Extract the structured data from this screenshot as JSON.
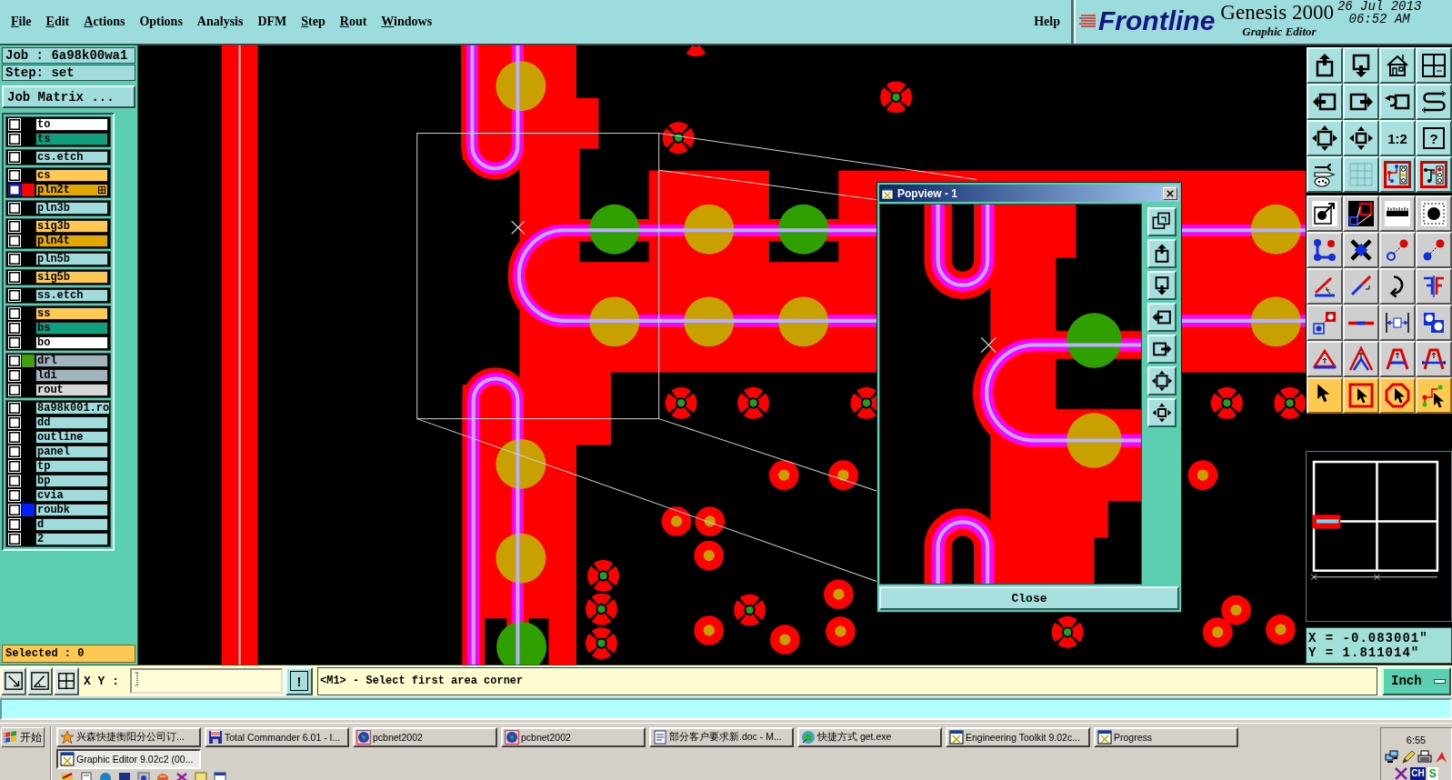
{
  "menu_bar": {
    "items": [
      {
        "label": "File",
        "underlined": true
      },
      {
        "label": "Edit",
        "underlined": true
      },
      {
        "label": "Actions",
        "underlined": true
      },
      {
        "label": "Options",
        "underlined": false
      },
      {
        "label": "Analysis",
        "underlined": false
      },
      {
        "label": "DFM",
        "underlined": false
      },
      {
        "label": "Step",
        "underlined": true
      },
      {
        "label": "Rout",
        "underlined": true
      },
      {
        "label": "Windows",
        "underlined": true
      }
    ],
    "help": {
      "label": "Help",
      "underlined": false
    }
  },
  "brand": {
    "logo": "Frontline",
    "product": "Genesis 2000",
    "subtitle": "Graphic Editor",
    "date": "26 Jul 2013",
    "time": "06:52 AM"
  },
  "job_panel": {
    "job": "Job : 6a98k00wa1",
    "step": "Step: set",
    "matrix_button": "Job Matrix ...",
    "layer_groups": [
      {
        "layers": [
          {
            "name": "to",
            "color": "#ffffff",
            "checked": false,
            "selected": false
          },
          {
            "name": "ts",
            "color": "#10a080",
            "checked": false,
            "selected": false
          }
        ]
      },
      {
        "layers": [
          {
            "name": "cs.etch",
            "color": "#a0dcdc",
            "checked": false,
            "selected": false
          }
        ]
      },
      {
        "layers": [
          {
            "name": "cs",
            "color": "#ffc850",
            "checked": false,
            "selected": false
          },
          {
            "name": "pln2t",
            "color": "#e0a800",
            "swatch": {
              "color": "#ff0000"
            },
            "checked": false,
            "selected": true
          }
        ]
      },
      {
        "layers": [
          {
            "name": "pln3b",
            "color": "#a0dcdc",
            "checked": false,
            "selected": false
          }
        ]
      },
      {
        "layers": [
          {
            "name": "sig3b",
            "color": "#ffc850",
            "checked": false,
            "selected": false
          },
          {
            "name": "pln4t",
            "color": "#e0a800",
            "checked": false,
            "selected": false
          }
        ]
      },
      {
        "layers": [
          {
            "name": "pln5b",
            "color": "#a0dcdc",
            "checked": false,
            "selected": false
          }
        ]
      },
      {
        "layers": [
          {
            "name": "sig5b",
            "color": "#ffc850",
            "checked": false,
            "selected": false
          }
        ]
      },
      {
        "layers": [
          {
            "name": "ss.etch",
            "color": "#a0dcdc",
            "checked": false,
            "selected": false
          }
        ]
      },
      {
        "layers": [
          {
            "name": "ss",
            "color": "#ffc850",
            "checked": false,
            "selected": false
          },
          {
            "name": "bs",
            "color": "#10a080",
            "checked": false,
            "selected": false
          },
          {
            "name": "bo",
            "color": "#ffffff",
            "checked": false,
            "selected": false
          }
        ]
      },
      {
        "layers": [
          {
            "name": "drl",
            "color": "#a0b4bc",
            "swatch": {
              "color": "#40a010"
            },
            "checked": false,
            "selected": false
          },
          {
            "name": "ldi",
            "color": "#a0b4bc",
            "checked": false,
            "selected": false
          },
          {
            "name": "rout",
            "color": "#d8d8d8",
            "checked": false,
            "selected": false
          }
        ]
      },
      {
        "layers": [
          {
            "name": "8a98k001.ro",
            "color": "#a0dcdc",
            "checked": false,
            "selected": false
          },
          {
            "name": "dd",
            "color": "#a0dcdc",
            "checked": false,
            "selected": false
          },
          {
            "name": "outline",
            "color": "#a0dcdc",
            "checked": false,
            "selected": false
          },
          {
            "name": "panel",
            "color": "#a0dcdc",
            "checked": false,
            "selected": false
          },
          {
            "name": "tp",
            "color": "#a0dcdc",
            "checked": false,
            "selected": false
          },
          {
            "name": "bp",
            "color": "#a0dcdc",
            "checked": false,
            "selected": false
          },
          {
            "name": "cvia",
            "color": "#a0dcdc",
            "checked": false,
            "selected": false
          },
          {
            "name": "roubk",
            "color": "#a0dcdc",
            "swatch": {
              "color": "#0020ff"
            },
            "checked": false,
            "selected": false
          },
          {
            "name": "d",
            "color": "#a0dcdc",
            "checked": false,
            "selected": false
          },
          {
            "name": "2",
            "color": "#a0dcdc",
            "checked": false,
            "selected": false
          }
        ]
      }
    ],
    "selected_count": "Selected : 0"
  },
  "toolbar": {
    "scale_button": "1:2",
    "help_button": "?"
  },
  "popview": {
    "title": "Popview - 1",
    "close_button": "Close"
  },
  "coordinates": {
    "x": "X = -0.083001\"",
    "y": "Y = 1.811014\""
  },
  "command_line": {
    "xy_label": "X Y :",
    "alert_button": "!",
    "message": "<M1> - Select first area corner",
    "units_button": "Inch"
  },
  "taskbar": {
    "start_button": "开始",
    "rows": [
      [
        {
          "label": "兴森快捷衡阳分公司订...",
          "kind": "star",
          "selected": false
        },
        {
          "label": "Total Commander 6.01 - I...",
          "kind": "floppy",
          "selected": false
        },
        {
          "label": "pcbnet2002",
          "kind": "globe",
          "selected": false
        },
        {
          "label": "pcbnet2002",
          "kind": "globe",
          "selected": false
        },
        {
          "label": "部分客户要求新.doc - M...",
          "kind": "document",
          "selected": false
        },
        {
          "label": "快捷方式 get.exe",
          "kind": "shortcut",
          "selected": false
        },
        {
          "label": "Engineering Toolkit 9.02c...",
          "kind": "window",
          "selected": false
        },
        {
          "label": "Progress",
          "kind": "window",
          "selected": false
        }
      ],
      [
        {
          "label": "Graphic Editor 9.02c2 (00...",
          "kind": "window",
          "selected": true
        }
      ]
    ],
    "clock": "6:55",
    "language": "CH",
    "tray_badge": "S"
  }
}
